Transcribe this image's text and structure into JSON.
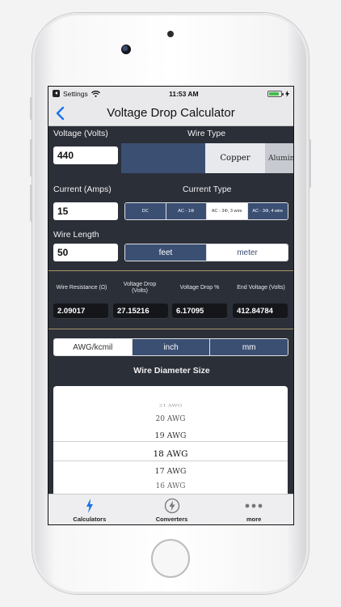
{
  "status_bar": {
    "back_app": "Settings",
    "time": "11:53 AM"
  },
  "nav": {
    "title": "Voltage Drop Calculator"
  },
  "voltage": {
    "label": "Voltage (Volts)",
    "value": "440"
  },
  "wire_type": {
    "label": "Wire Type",
    "options": [
      "Copper",
      "Alumin"
    ],
    "selected": "Copper"
  },
  "current": {
    "label": "Current (Amps)",
    "value": "15"
  },
  "current_type": {
    "label": "Current Type",
    "options": [
      "DC",
      "AC - 1Φ",
      "AC - 3Φ, 3 wire",
      "AC - 3Φ, 4 wire"
    ],
    "selected": "AC - 3Φ, 3 wire"
  },
  "wire_length": {
    "label": "Wire Length",
    "value": "50",
    "units": [
      "feet",
      "meter"
    ],
    "selected_unit": "feet"
  },
  "results": [
    {
      "label": "Wire Resistance (Ω)",
      "value": "2.09017"
    },
    {
      "label": "Voltage Drop (Volts)",
      "value": "27.15216"
    },
    {
      "label": "Voltage Drop %",
      "value": "6.17095"
    },
    {
      "label": "End Voltage (Volts)",
      "value": "412.84784"
    }
  ],
  "size_units": {
    "options": [
      "AWG/kcmil",
      "inch",
      "mm"
    ],
    "selected": "AWG/kcmil"
  },
  "diameter": {
    "title": "Wire Diameter Size",
    "picker_items": [
      "21 AWG",
      "20 AWG",
      "19 AWG",
      "18 AWG",
      "17 AWG",
      "16 AWG"
    ],
    "selected": "18 AWG"
  },
  "tabs": [
    {
      "label": "Calculators",
      "icon": "bolt-icon"
    },
    {
      "label": "Converters",
      "icon": "bolt-circle-icon"
    },
    {
      "label": "more",
      "icon": "more-icon"
    }
  ],
  "colors": {
    "accent": "#3b4f73",
    "background": "#2b2f38",
    "ios_blue": "#1a73e8",
    "divider": "#a79767"
  }
}
